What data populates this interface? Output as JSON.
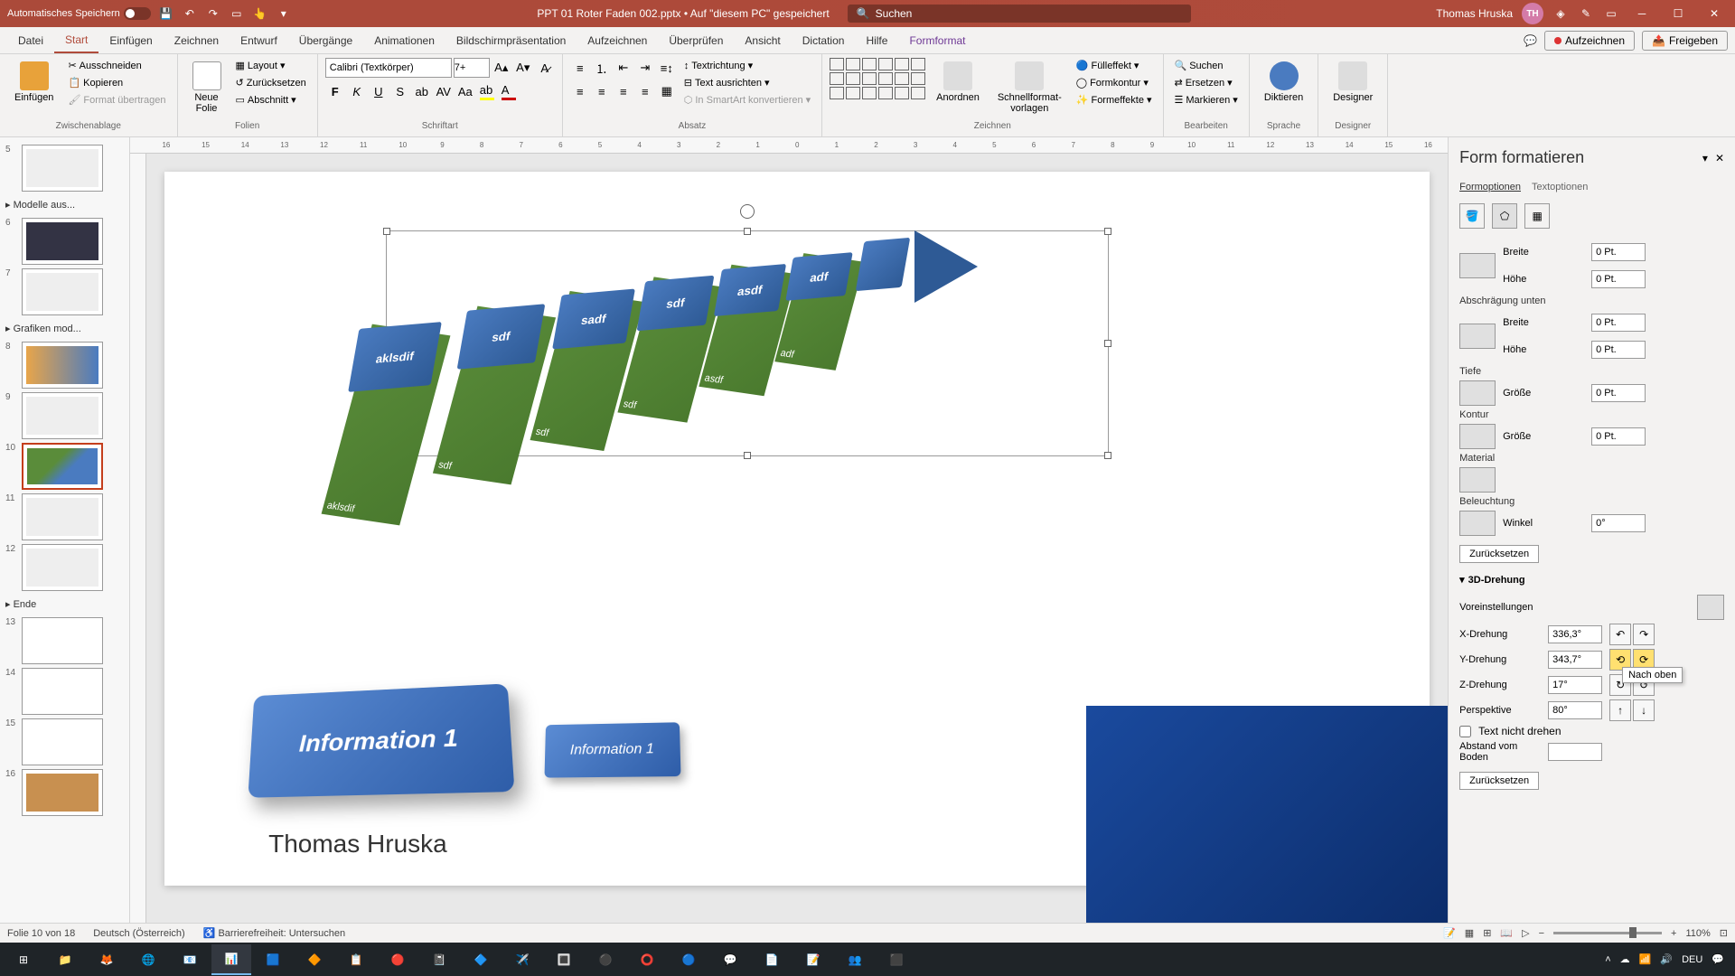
{
  "titlebar": {
    "autosave": "Automatisches Speichern",
    "doc_title": "PPT 01 Roter Faden 002.pptx • Auf \"diesem PC\" gespeichert",
    "search_placeholder": "Suchen",
    "user_name": "Thomas Hruska",
    "user_initials": "TH"
  },
  "tabs": {
    "items": [
      "Datei",
      "Start",
      "Einfügen",
      "Zeichnen",
      "Entwurf",
      "Übergänge",
      "Animationen",
      "Bildschirmpräsentation",
      "Aufzeichnen",
      "Überprüfen",
      "Ansicht",
      "Dictation",
      "Hilfe",
      "Formformat"
    ],
    "active": "Start",
    "record": "Aufzeichnen",
    "share": "Freigeben"
  },
  "ribbon": {
    "zwischenablage": {
      "label": "Zwischenablage",
      "paste": "Einfügen",
      "cut": "Ausschneiden",
      "copy": "Kopieren",
      "format": "Format übertragen"
    },
    "folien": {
      "label": "Folien",
      "new": "Neue\nFolie",
      "layout": "Layout",
      "reset": "Zurücksetzen",
      "section": "Abschnitt"
    },
    "schriftart": {
      "label": "Schriftart",
      "font": "Calibri (Textkörper)",
      "size": "7+"
    },
    "absatz": {
      "label": "Absatz",
      "textdir": "Textrichtung",
      "align": "Text ausrichten",
      "smartart": "In SmartArt konvertieren"
    },
    "zeichnen": {
      "label": "Zeichnen",
      "arrange": "Anordnen",
      "quickstyles": "Schnellformat-\nvorlagen",
      "fill": "Fülleffekt",
      "outline": "Formkontur",
      "effects": "Formeffekte"
    },
    "bearbeiten": {
      "label": "Bearbeiten",
      "find": "Suchen",
      "replace": "Ersetzen",
      "select": "Markieren"
    },
    "sprache": {
      "label": "Sprache",
      "dictate": "Diktieren"
    },
    "designer": {
      "label": "Designer",
      "btn": "Designer"
    }
  },
  "thumbnails": {
    "sections": [
      "Modelle aus...",
      "Grafiken mod...",
      "Ende"
    ],
    "items": [
      {
        "num": "5"
      },
      {
        "num": "6"
      },
      {
        "num": "7"
      },
      {
        "num": "8"
      },
      {
        "num": "9"
      },
      {
        "num": "10"
      },
      {
        "num": "11"
      },
      {
        "num": "12"
      },
      {
        "num": "13"
      },
      {
        "num": "14"
      },
      {
        "num": "15"
      },
      {
        "num": "16"
      }
    ]
  },
  "slide": {
    "ruler_ticks": [
      "16",
      "15",
      "14",
      "13",
      "12",
      "11",
      "10",
      "9",
      "8",
      "7",
      "6",
      "5",
      "4",
      "3",
      "2",
      "1",
      "0",
      "1",
      "2",
      "3",
      "4",
      "5",
      "6",
      "7",
      "8",
      "9",
      "10",
      "11",
      "12",
      "13",
      "14",
      "15",
      "16"
    ],
    "blocks": [
      "aklsdif",
      "sdf",
      "sadf",
      "sdf",
      "asdf",
      "adf"
    ],
    "green_labels": [
      "aklsdif",
      "sdf",
      "sdf",
      "sdf",
      "asdf",
      "adf"
    ],
    "info1": "Information 1",
    "info2": "Information 1",
    "author": "Thomas Hruska"
  },
  "format_pane": {
    "title": "Form formatieren",
    "tab1": "Formoptionen",
    "tab2": "Textoptionen",
    "breite": "Breite",
    "hoehe": "Höhe",
    "abschraegung": "Abschrägung unten",
    "tiefe": "Tiefe",
    "groesse": "Größe",
    "kontur": "Kontur",
    "material": "Material",
    "beleuchtung": "Beleuchtung",
    "winkel": "Winkel",
    "zuruecksetzen": "Zurücksetzen",
    "drehung3d": "3D-Drehung",
    "voreinstellungen": "Voreinstellungen",
    "xdrehung": "X-Drehung",
    "ydrehung": "Y-Drehung",
    "zdrehung": "Z-Drehung",
    "perspektive": "Perspektive",
    "textnicht": "Text nicht drehen",
    "abstand": "Abstand vom Boden",
    "val_breite": "0 Pt.",
    "val_hoehe": "0 Pt.",
    "val_groesse": "0 Pt.",
    "val_winkel": "0°",
    "val_x": "336,3°",
    "val_y": "343,7°",
    "val_z": "17°",
    "val_persp": "80°",
    "tooltip": "Nach oben"
  },
  "statusbar": {
    "slide_info": "Folie 10 von 18",
    "lang": "Deutsch (Österreich)",
    "access": "Barrierefreiheit: Untersuchen",
    "zoom": "110%"
  },
  "taskbar": {
    "lang": "DEU"
  }
}
